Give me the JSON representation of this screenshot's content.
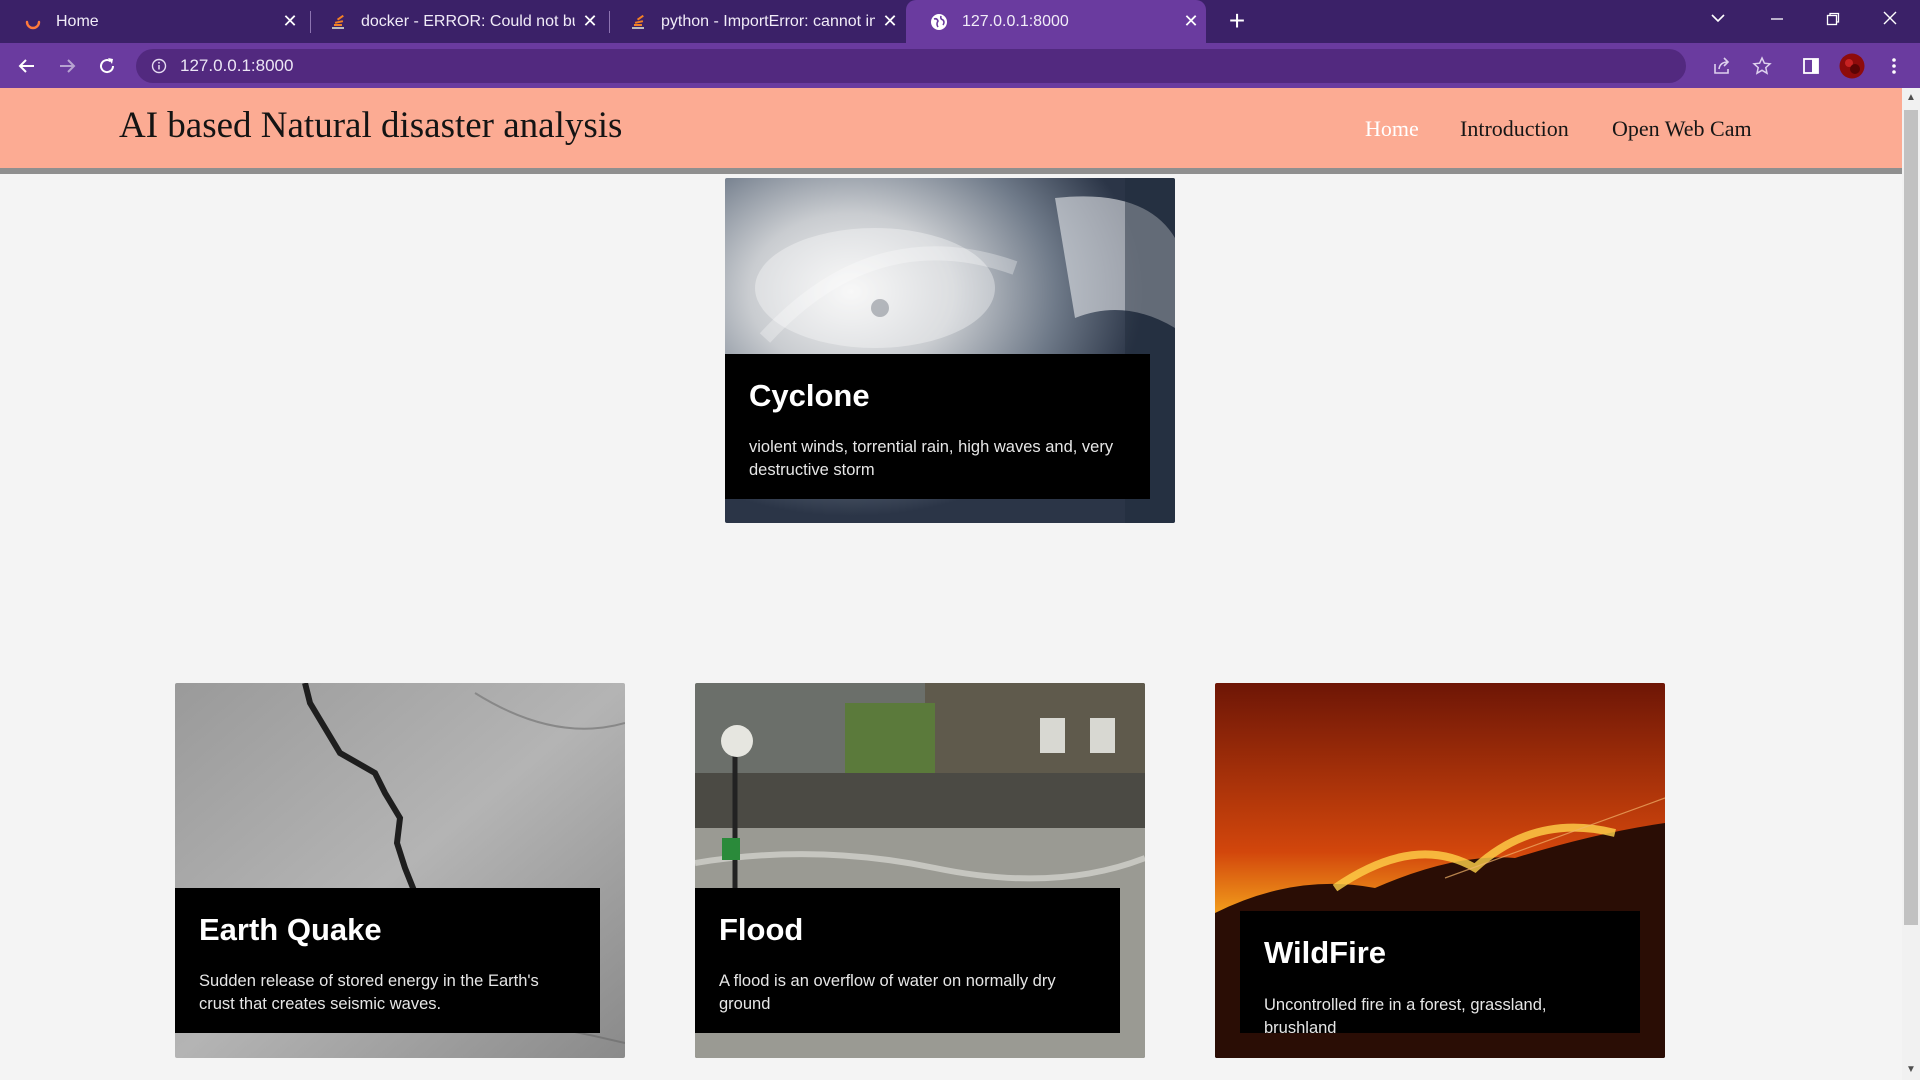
{
  "browser": {
    "tabs": [
      {
        "title": "Home",
        "icon": "loading-spinner-icon"
      },
      {
        "title": "docker - ERROR: Could not build",
        "icon": "stack-overflow-icon"
      },
      {
        "title": "python - ImportError: cannot imp",
        "icon": "stack-overflow-icon"
      },
      {
        "title": "127.0.0.1:8000",
        "icon": "globe-icon"
      }
    ],
    "url": "127.0.0.1:8000",
    "colors": {
      "tabbar": "#3b2168",
      "toolbar": "#6a3b9f",
      "omnibox": "#52297f"
    }
  },
  "site": {
    "brand": "AI based Natural disaster analysis",
    "nav": [
      "Home",
      "Introduction",
      "Open Web Cam"
    ],
    "header_color": "#fcab93"
  },
  "cards": [
    {
      "title": "Cyclone",
      "description": "violent winds, torrential rain, high waves and, very destructive storm",
      "image": "satellite-cyclone-image"
    },
    {
      "title": "Earth Quake",
      "description": "Sudden release of stored energy in the Earth's crust that creates seismic waves.",
      "image": "cracked-ground-image"
    },
    {
      "title": "Flood",
      "description": "A flood is an overflow of water on normally dry ground",
      "image": "flooded-street-image"
    },
    {
      "title": "WildFire",
      "description": "Uncontrolled fire in a forest, grassland, brushland",
      "image": "wildfire-hillside-image"
    }
  ]
}
